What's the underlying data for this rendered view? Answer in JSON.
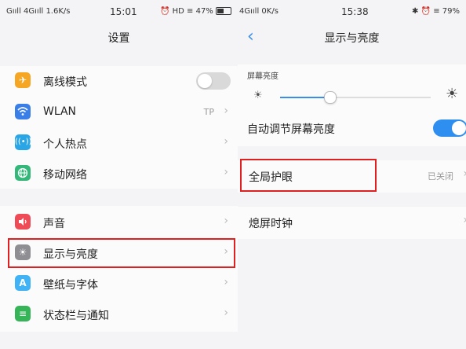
{
  "left": {
    "status": {
      "signal_left": "Gııll 4Gııll 1.6K/s",
      "time": "15:01",
      "signal_right": "⏰ HD ≡ 47%"
    },
    "title": "设置",
    "group1": [
      {
        "label": "离线模式",
        "icon": "airplane-icon",
        "color": "#f5a623",
        "glyph": "✈",
        "toggle": "off"
      },
      {
        "label": "WLAN",
        "icon": "wifi-icon",
        "color": "#3a7ee8",
        "glyph": "≡",
        "value": "TP"
      },
      {
        "label": "个人热点",
        "icon": "hotspot-icon",
        "color": "#2aa6e6",
        "glyph": "◎"
      },
      {
        "label": "移动网络",
        "icon": "globe-icon",
        "color": "#34b87a",
        "glyph": "◍"
      }
    ],
    "group2": [
      {
        "label": "声音",
        "icon": "speaker-icon",
        "color": "#ef4b57",
        "glyph": "◀"
      },
      {
        "label": "显示与亮度",
        "icon": "brightness-icon",
        "color": "#8e8e93",
        "glyph": "☀"
      },
      {
        "label": "壁纸与字体",
        "icon": "font-icon",
        "color": "#3fb3f5",
        "glyph": "A"
      },
      {
        "label": "状态栏与通知",
        "icon": "notification-icon",
        "color": "#35b558",
        "glyph": "≡"
      }
    ]
  },
  "right": {
    "status": {
      "signal_left": "4Gııll 0K/s",
      "time": "15:38",
      "signal_right": "✱ ⏰ ≡ 79%"
    },
    "title": "显示与亮度",
    "brightness_caption": "屏幕亮度",
    "brightness_level": 0.33,
    "auto_brightness_label": "自动调节屏幕亮度",
    "auto_brightness_toggle": "on",
    "eye_protect_label": "全局护眼",
    "eye_protect_value": "已关闭",
    "screen_timeout_label": "熄屏时钟"
  },
  "colors": {
    "accent": "#3a8de8",
    "highlight": "#e02020"
  }
}
